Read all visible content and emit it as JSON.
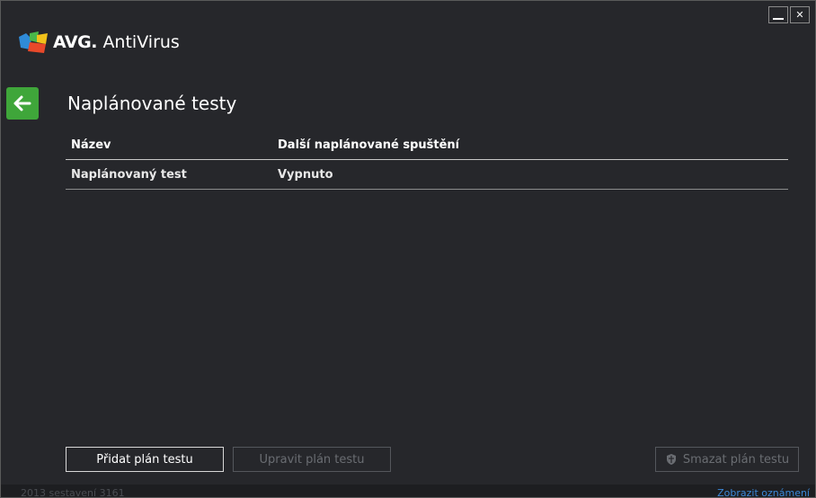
{
  "app": {
    "brand": "AVG",
    "product": "AntiVirus"
  },
  "window_controls": {
    "minimize": "minimize",
    "close": "close"
  },
  "page": {
    "title": "Naplánované testy"
  },
  "table": {
    "columns": [
      "Název",
      "Další naplánované spuštění"
    ],
    "rows": [
      {
        "name": "Naplánovaný test",
        "next_run": "Vypnuto"
      }
    ]
  },
  "buttons": {
    "add": "Přidat plán testu",
    "edit": "Upravit plán testu",
    "delete": "Smazat plán testu"
  },
  "status": {
    "build": "2013  sestavení 3161",
    "notify_link": "Zobrazit oznámení"
  },
  "colors": {
    "background": "#26272b",
    "back_button": "#3fa63a",
    "link": "#3b88d8",
    "disabled_text": "#6a6d72"
  },
  "icons": {
    "back": "arrow-left-icon",
    "logo": "avg-logo-icon",
    "delete": "shield-icon"
  }
}
